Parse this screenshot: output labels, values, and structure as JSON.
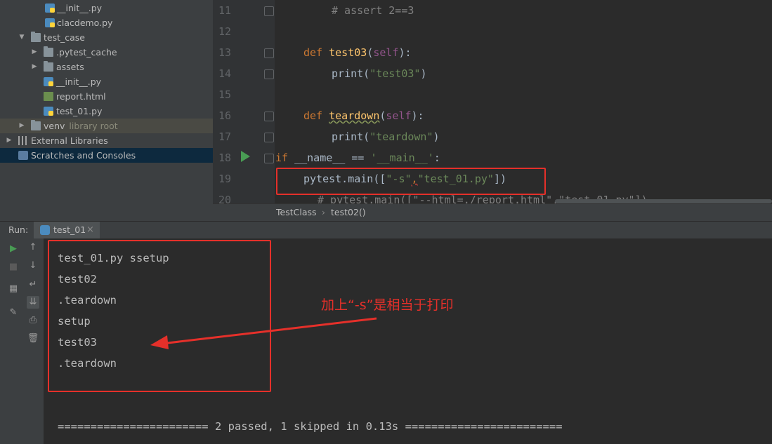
{
  "project_tree": {
    "items": [
      {
        "label": "__init__.py",
        "icon": "python-file-icon"
      },
      {
        "label": "clacdemo.py",
        "icon": "python-file-icon"
      },
      {
        "label": "test_case",
        "icon": "folder-icon"
      },
      {
        "label": ".pytest_cache",
        "icon": "folder-icon"
      },
      {
        "label": "assets",
        "icon": "folder-icon"
      },
      {
        "label": "__init__.py",
        "icon": "python-file-icon"
      },
      {
        "label": "report.html",
        "icon": "html-file-icon"
      },
      {
        "label": "test_01.py",
        "icon": "python-file-icon"
      },
      {
        "label": "venv",
        "suffix": "library root",
        "icon": "folder-icon"
      },
      {
        "label": "External Libraries",
        "icon": "library-icon"
      },
      {
        "label": "Scratches and Consoles",
        "icon": "scratches-icon"
      }
    ]
  },
  "editor": {
    "line_numbers": [
      "11",
      "12",
      "13",
      "14",
      "15",
      "16",
      "17",
      "18",
      "19",
      "20"
    ],
    "lines": {
      "l11": "# assert 2==3",
      "l13_kw": "def",
      "l13_fn": "test03",
      "l13_open": "(",
      "l13_self": "self",
      "l13_close": "):",
      "l14_print": "print(",
      "l14_str": "\"test03\"",
      "l14_close": ")",
      "l16_kw": "def",
      "l16_fn": "teardown",
      "l16_open": "(",
      "l16_self": "self",
      "l16_close": "):",
      "l17_print": "print(",
      "l17_str": "\"teardown\"",
      "l17_close": ")",
      "l18_kw": "if",
      "l18_rest": " __name__ == ",
      "l18_str": "'__main__'",
      "l18_colon": ":",
      "l19_a": "pytest.main([",
      "l19_s1": "\"-s\"",
      "l19_comma": ",",
      "l19_s2": "\"test_01.py\"",
      "l19_b": "])",
      "l20": "# pytest.main([\"--html=./report.html\",\"test_01.py\"])"
    }
  },
  "breadcrumb": {
    "class": "TestClass",
    "sep": "›",
    "method": "test02()"
  },
  "run_panel": {
    "label": "Run:",
    "tab_label": "test_01",
    "tab_close": "×",
    "output": [
      "test_01.py ssetup",
      "test02",
      ".teardown",
      "setup",
      "test03",
      ".teardown"
    ],
    "summary": "======================= 2 passed, 1 skipped in 0.13s ========================"
  },
  "annotation": {
    "note": "加上“-s”是相当于打印",
    "color": "#e5302a"
  },
  "colors": {
    "keyword": "#cc7832",
    "function": "#ffc66d",
    "string": "#6a8759",
    "self": "#94558d",
    "run_green": "#499c54"
  }
}
